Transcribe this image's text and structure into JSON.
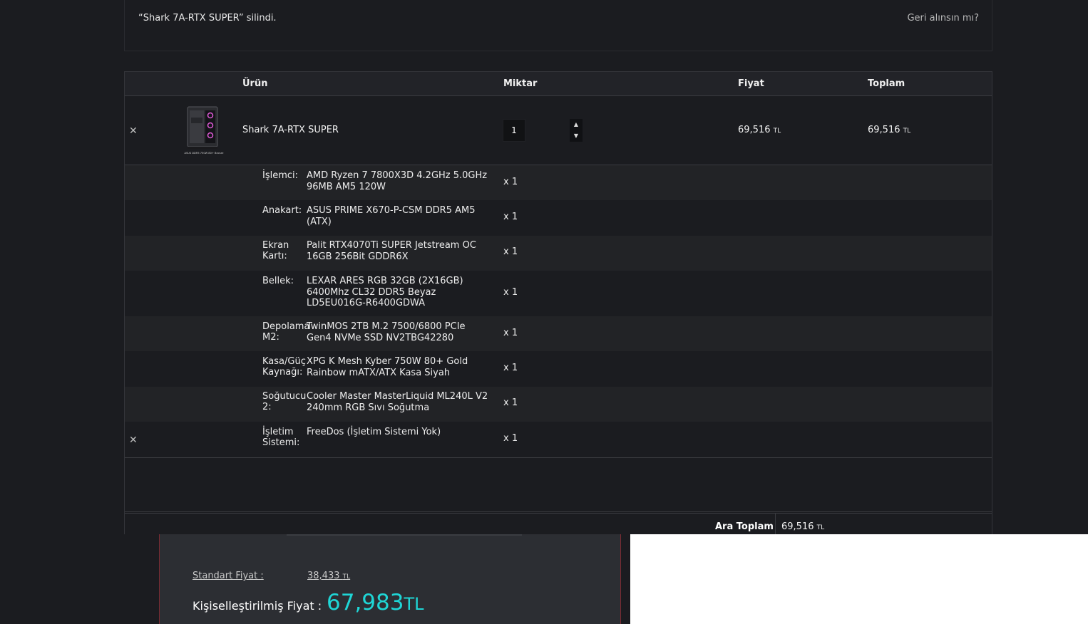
{
  "notice": {
    "message": "“Shark 7A-RTX SUPER” silindi.",
    "undo_link": "Geri alınsın mı?"
  },
  "cart": {
    "headers": {
      "product": "Ürün",
      "quantity": "Miktar",
      "price": "Fiyat",
      "total": "Toplam"
    },
    "item": {
      "name": "Shark 7A-RTX SUPER",
      "quantity": "1",
      "price": "69,516",
      "total": "69,516",
      "currency": "TL",
      "remove_icon": "close-icon",
      "thumbnail_caption": "ASUS DDR5 750W 80+ Bronze"
    },
    "components": [
      {
        "label": "İşlemci:",
        "value": "AMD Ryzen 7 7800X3D 4.2GHz 5.0GHz 96MB AM5 120W",
        "qty": "x 1"
      },
      {
        "label": "Anakart:",
        "value": "ASUS PRIME X670-P-CSM DDR5 AM5 (ATX)",
        "qty": "x 1"
      },
      {
        "label": "Ekran Kartı:",
        "value": "Palit RTX4070Ti SUPER Jetstream OC 16GB 256Bit GDDR6X",
        "qty": "x 1"
      },
      {
        "label": "Bellek:",
        "value": "LEXAR ARES RGB 32GB (2X16GB) 6400Mhz CL32 DDR5 Beyaz LD5EU016G-R6400GDWA",
        "qty": "x 1"
      },
      {
        "label": "Depolama M2:",
        "value": "TwinMOS 2TB M.2 7500/6800 PCIe Gen4 NVMe SSD NV2TBG42280",
        "qty": "x 1"
      },
      {
        "label": "Kasa/Güç Kaynağı:",
        "value": "XPG K Mesh Kyber 750W 80+ Gold Rainbow mATX/ATX Kasa Siyah",
        "qty": "x 1"
      },
      {
        "label": "Soğutucu 2:",
        "value": "Cooler Master MasterLiquid ML240L V2 240mm RGB Sıvı Soğutma",
        "qty": "x 1"
      },
      {
        "label": "İşletim Sistemi:",
        "value": "FreeDos (İşletim Sistemi Yok)",
        "qty": "x 1"
      }
    ],
    "subtotal_label": "Ara Toplam",
    "subtotal_value": "69,516",
    "currency": "TL"
  },
  "pricing_popup": {
    "standard_label": "Standart Fiyat :",
    "standard_value": "38,433",
    "standard_currency": "TL",
    "custom_label": "Kişiselleştirilmiş Fiyat :",
    "custom_value": "67,983",
    "custom_currency": "TL"
  },
  "colors": {
    "background": "#1b1c20",
    "accent_cyan": "#1fd6d6",
    "popup_border": "#7a2a32"
  }
}
